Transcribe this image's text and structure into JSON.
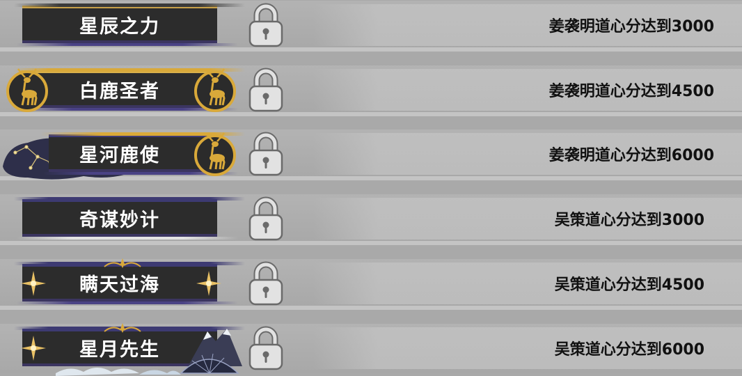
{
  "achievements": [
    {
      "title": "星辰之力",
      "condition": "姜袭明道心分达到3000",
      "badge_left": "none",
      "badge_right": "none",
      "locked": true
    },
    {
      "title": "白鹿圣者",
      "condition": "姜袭明道心分达到4500",
      "badge_left": "deer-medallion-icon",
      "badge_right": "deer-medallion-icon",
      "locked": true
    },
    {
      "title": "星河鹿使",
      "condition": "姜袭明道心分达到6000",
      "badge_left": "constellation-cloud-icon",
      "badge_right": "deer-medallion-icon",
      "locked": true
    },
    {
      "title": "奇谋妙计",
      "condition": "吴策道心分达到3000",
      "badge_left": "none",
      "badge_right": "none",
      "locked": true
    },
    {
      "title": "瞒天过海",
      "condition": "吴策道心分达到4500",
      "badge_left": "gold-star-icon",
      "badge_right": "gold-star-icon",
      "locked": true
    },
    {
      "title": "星月先生",
      "condition": "吴策道心分达到6000",
      "badge_left": "gold-star-icon",
      "badge_right": "mountain-fan-icon",
      "locked": true
    }
  ],
  "colors": {
    "plate": "#2c2c2c",
    "gold": "#d9a93a",
    "indigo": "#3d3a72",
    "lock_fill": "#e0e0e0",
    "lock_stroke": "#6a6a6a"
  }
}
